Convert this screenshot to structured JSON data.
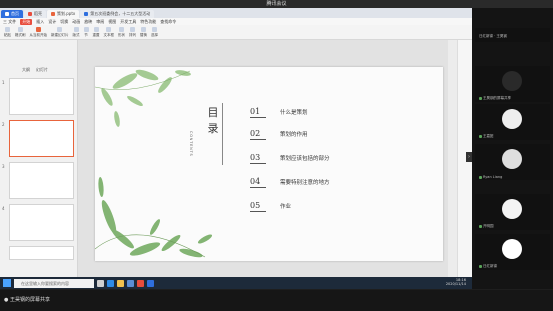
{
  "meeting": {
    "title": "腾讯会议"
  },
  "wps": {
    "tabs": [
      {
        "label": "首页",
        "icon": "wps-home-icon"
      },
      {
        "label": "稻壳",
        "icon": "docer-icon"
      },
      {
        "label": "策划.pptx",
        "icon": "ppt-file-icon"
      },
      {
        "label": "第五次班委例会，十二五大型活动",
        "icon": "doc-file-icon"
      }
    ],
    "menu": [
      "三 文件",
      "开始",
      "插入",
      "设计",
      "切换",
      "动画",
      "放映",
      "审阅",
      "视图",
      "开发工具",
      "特色功能",
      "查找命令"
    ],
    "menu_active_index": 1,
    "ribbon": [
      "粘贴",
      "格式刷",
      "从当前开始",
      "新建幻灯片",
      "版式",
      "节",
      "重置",
      "文本框",
      "形状",
      "排列",
      "替换",
      "选择"
    ],
    "panel_tabs": [
      "大纲",
      "幻灯片"
    ],
    "status": [
      "幻灯片 2 / 14",
      "Office 主题",
      "缺失字体"
    ],
    "zoom": "56%"
  },
  "slide": {
    "title": "目录",
    "subtitle": "CONTENTS",
    "entries": [
      {
        "num": "01",
        "text": "什么是策划"
      },
      {
        "num": "02",
        "text": "策划的作用"
      },
      {
        "num": "03",
        "text": "策划应该包括的部分"
      },
      {
        "num": "04",
        "text": "需要特别注意的地方"
      },
      {
        "num": "05",
        "text": "作业"
      }
    ]
  },
  "taskbar": {
    "search_placeholder": "在这里输入你要搜索的内容",
    "time": "18:16",
    "date": "2020/11/14"
  },
  "share": {
    "label": "● 王昊钢的屏幕共享"
  },
  "participants": [
    {
      "name": "日红新锦 · 王昊钢",
      "avatar_color": "#1a1a1a"
    },
    {
      "name": "王昊钢的屏幕共享",
      "avatar_color": "#2a2a2a"
    },
    {
      "name": "王嘉懿",
      "avatar_color": "#efefef"
    },
    {
      "name": "Ryan Liang",
      "avatar_color": "#dedede"
    },
    {
      "name": "开明园",
      "avatar_color": "#f4f4f4"
    },
    {
      "name": "日红新锦",
      "avatar_color": "#ffffff"
    }
  ],
  "colors": {
    "accent": "#e84d3d",
    "wps_blue": "#2f6fde",
    "selected_thumb": "#e8643c"
  }
}
